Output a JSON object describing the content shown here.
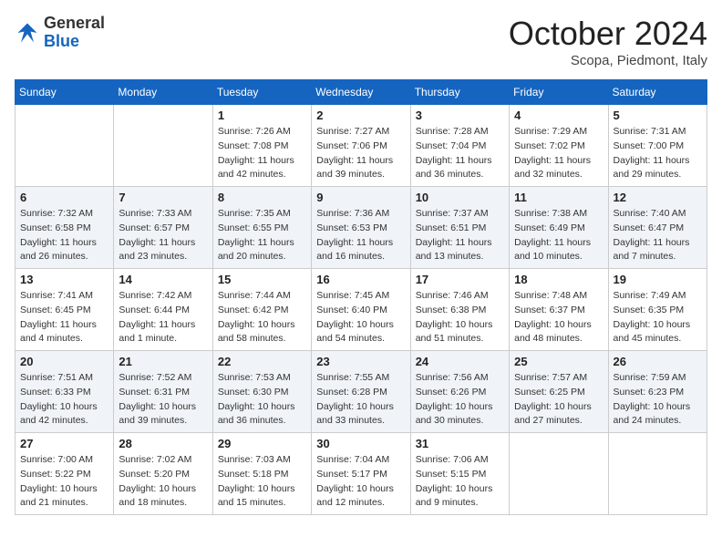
{
  "header": {
    "logo_general": "General",
    "logo_blue": "Blue",
    "month_title": "October 2024",
    "location": "Scopa, Piedmont, Italy"
  },
  "columns": [
    "Sunday",
    "Monday",
    "Tuesday",
    "Wednesday",
    "Thursday",
    "Friday",
    "Saturday"
  ],
  "weeks": [
    [
      {
        "day": "",
        "info": ""
      },
      {
        "day": "",
        "info": ""
      },
      {
        "day": "1",
        "info": "Sunrise: 7:26 AM\nSunset: 7:08 PM\nDaylight: 11 hours and 42 minutes."
      },
      {
        "day": "2",
        "info": "Sunrise: 7:27 AM\nSunset: 7:06 PM\nDaylight: 11 hours and 39 minutes."
      },
      {
        "day": "3",
        "info": "Sunrise: 7:28 AM\nSunset: 7:04 PM\nDaylight: 11 hours and 36 minutes."
      },
      {
        "day": "4",
        "info": "Sunrise: 7:29 AM\nSunset: 7:02 PM\nDaylight: 11 hours and 32 minutes."
      },
      {
        "day": "5",
        "info": "Sunrise: 7:31 AM\nSunset: 7:00 PM\nDaylight: 11 hours and 29 minutes."
      }
    ],
    [
      {
        "day": "6",
        "info": "Sunrise: 7:32 AM\nSunset: 6:58 PM\nDaylight: 11 hours and 26 minutes."
      },
      {
        "day": "7",
        "info": "Sunrise: 7:33 AM\nSunset: 6:57 PM\nDaylight: 11 hours and 23 minutes."
      },
      {
        "day": "8",
        "info": "Sunrise: 7:35 AM\nSunset: 6:55 PM\nDaylight: 11 hours and 20 minutes."
      },
      {
        "day": "9",
        "info": "Sunrise: 7:36 AM\nSunset: 6:53 PM\nDaylight: 11 hours and 16 minutes."
      },
      {
        "day": "10",
        "info": "Sunrise: 7:37 AM\nSunset: 6:51 PM\nDaylight: 11 hours and 13 minutes."
      },
      {
        "day": "11",
        "info": "Sunrise: 7:38 AM\nSunset: 6:49 PM\nDaylight: 11 hours and 10 minutes."
      },
      {
        "day": "12",
        "info": "Sunrise: 7:40 AM\nSunset: 6:47 PM\nDaylight: 11 hours and 7 minutes."
      }
    ],
    [
      {
        "day": "13",
        "info": "Sunrise: 7:41 AM\nSunset: 6:45 PM\nDaylight: 11 hours and 4 minutes."
      },
      {
        "day": "14",
        "info": "Sunrise: 7:42 AM\nSunset: 6:44 PM\nDaylight: 11 hours and 1 minute."
      },
      {
        "day": "15",
        "info": "Sunrise: 7:44 AM\nSunset: 6:42 PM\nDaylight: 10 hours and 58 minutes."
      },
      {
        "day": "16",
        "info": "Sunrise: 7:45 AM\nSunset: 6:40 PM\nDaylight: 10 hours and 54 minutes."
      },
      {
        "day": "17",
        "info": "Sunrise: 7:46 AM\nSunset: 6:38 PM\nDaylight: 10 hours and 51 minutes."
      },
      {
        "day": "18",
        "info": "Sunrise: 7:48 AM\nSunset: 6:37 PM\nDaylight: 10 hours and 48 minutes."
      },
      {
        "day": "19",
        "info": "Sunrise: 7:49 AM\nSunset: 6:35 PM\nDaylight: 10 hours and 45 minutes."
      }
    ],
    [
      {
        "day": "20",
        "info": "Sunrise: 7:51 AM\nSunset: 6:33 PM\nDaylight: 10 hours and 42 minutes."
      },
      {
        "day": "21",
        "info": "Sunrise: 7:52 AM\nSunset: 6:31 PM\nDaylight: 10 hours and 39 minutes."
      },
      {
        "day": "22",
        "info": "Sunrise: 7:53 AM\nSunset: 6:30 PM\nDaylight: 10 hours and 36 minutes."
      },
      {
        "day": "23",
        "info": "Sunrise: 7:55 AM\nSunset: 6:28 PM\nDaylight: 10 hours and 33 minutes."
      },
      {
        "day": "24",
        "info": "Sunrise: 7:56 AM\nSunset: 6:26 PM\nDaylight: 10 hours and 30 minutes."
      },
      {
        "day": "25",
        "info": "Sunrise: 7:57 AM\nSunset: 6:25 PM\nDaylight: 10 hours and 27 minutes."
      },
      {
        "day": "26",
        "info": "Sunrise: 7:59 AM\nSunset: 6:23 PM\nDaylight: 10 hours and 24 minutes."
      }
    ],
    [
      {
        "day": "27",
        "info": "Sunrise: 7:00 AM\nSunset: 5:22 PM\nDaylight: 10 hours and 21 minutes."
      },
      {
        "day": "28",
        "info": "Sunrise: 7:02 AM\nSunset: 5:20 PM\nDaylight: 10 hours and 18 minutes."
      },
      {
        "day": "29",
        "info": "Sunrise: 7:03 AM\nSunset: 5:18 PM\nDaylight: 10 hours and 15 minutes."
      },
      {
        "day": "30",
        "info": "Sunrise: 7:04 AM\nSunset: 5:17 PM\nDaylight: 10 hours and 12 minutes."
      },
      {
        "day": "31",
        "info": "Sunrise: 7:06 AM\nSunset: 5:15 PM\nDaylight: 10 hours and 9 minutes."
      },
      {
        "day": "",
        "info": ""
      },
      {
        "day": "",
        "info": ""
      }
    ]
  ]
}
